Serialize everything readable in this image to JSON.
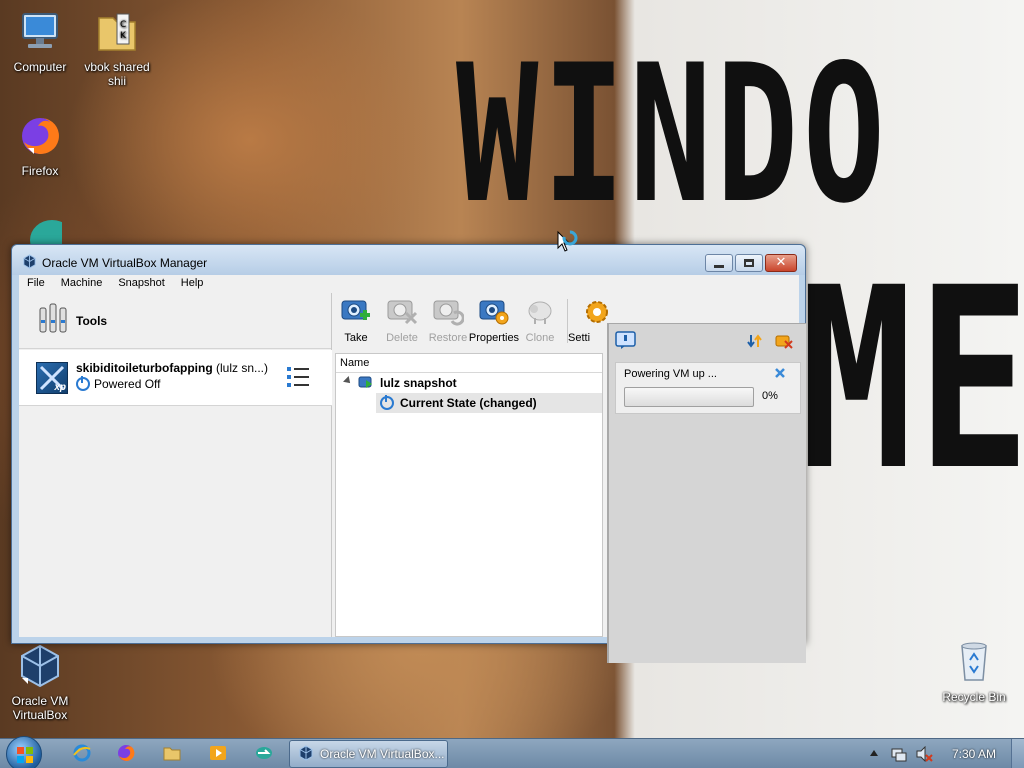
{
  "desktop": {
    "wallpaper_text_line1": "WINDO",
    "wallpaper_text_line2": "ME",
    "icons": {
      "computer": "Computer",
      "shared": "vbok shared shii",
      "firefox": "Firefox",
      "virtualbox": "Oracle VM VirtualBox",
      "recycle": "Recycle Bin"
    }
  },
  "window": {
    "title": "Oracle VM VirtualBox Manager",
    "menu": [
      "File",
      "Machine",
      "Snapshot",
      "Help"
    ],
    "tools_label": "Tools",
    "vm": {
      "name": "skibiditoileturbofapping",
      "snapshot_suffix": " (lulz sn...)",
      "state": "Powered Off"
    },
    "toolbar": {
      "take": "Take",
      "delete": "Delete",
      "restore": "Restore",
      "properties": "Properties",
      "clone": "Clone",
      "settings": "Setti"
    },
    "tree": {
      "header": "Name",
      "snapshot": "lulz snapshot",
      "current": "Current State (changed)"
    },
    "notification": {
      "message": "Powering VM up ...",
      "progress_percent": 0,
      "progress_text": "0%"
    }
  },
  "taskbar": {
    "task_label": "Oracle VM VirtualBox...",
    "clock": "7:30 AM"
  },
  "colors": {
    "titlebar": "#bcd3ea",
    "accent_blue": "#2a7ad1",
    "progress_fill": "#3cba4a",
    "close_red": "#c9452c"
  }
}
